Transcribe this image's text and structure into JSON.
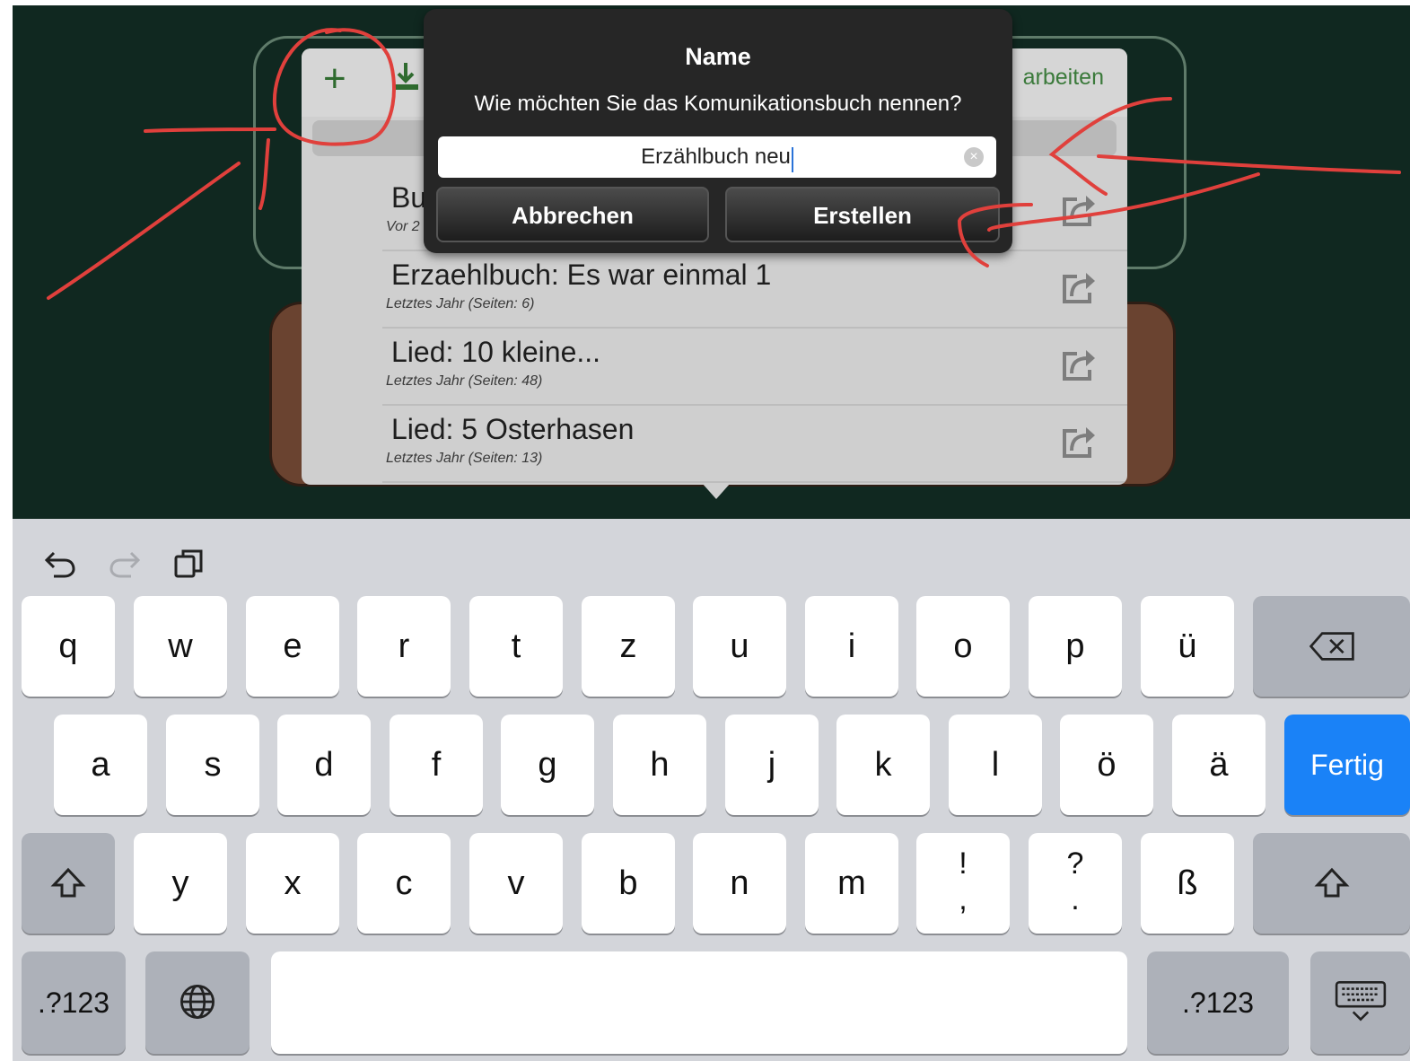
{
  "toolbar": {
    "edit_label": "arbeiten"
  },
  "books": [
    {
      "title": "Bu",
      "subtitle": "Vor 2"
    },
    {
      "title": "Erzaehlbuch: Es war einmal 1",
      "subtitle": "Letztes Jahr (Seiten: 6)"
    },
    {
      "title": "Lied: 10 kleine...",
      "subtitle": "Letztes Jahr (Seiten: 48)"
    },
    {
      "title": "Lied: 5 Osterhasen",
      "subtitle": "Letztes Jahr (Seiten: 13)"
    }
  ],
  "dialog": {
    "title": "Name",
    "message": "Wie möchten Sie das Komunikationsbuch nennen?",
    "input_value": "Erzählbuch neu",
    "cancel_label": "Abbrechen",
    "create_label": "Erstellen"
  },
  "keyboard": {
    "row1": [
      "q",
      "w",
      "e",
      "r",
      "t",
      "z",
      "u",
      "i",
      "o",
      "p",
      "ü"
    ],
    "row2": [
      "a",
      "s",
      "d",
      "f",
      "g",
      "h",
      "j",
      "k",
      "l",
      "ö",
      "ä"
    ],
    "row3": [
      "y",
      "x",
      "c",
      "v",
      "b",
      "n",
      "m"
    ],
    "punct1_top": "!",
    "punct1_bottom": ",",
    "punct2_top": "?",
    "punct2_bottom": ".",
    "eszett": "ß",
    "done_label": "Fertig",
    "numbers_left": ".?123",
    "numbers_right": ".?123"
  },
  "colors": {
    "app_background": "#102820",
    "accent_green": "#3b7a3b",
    "done_blue": "#1a82f7",
    "annotation_red": "#e0403c"
  }
}
